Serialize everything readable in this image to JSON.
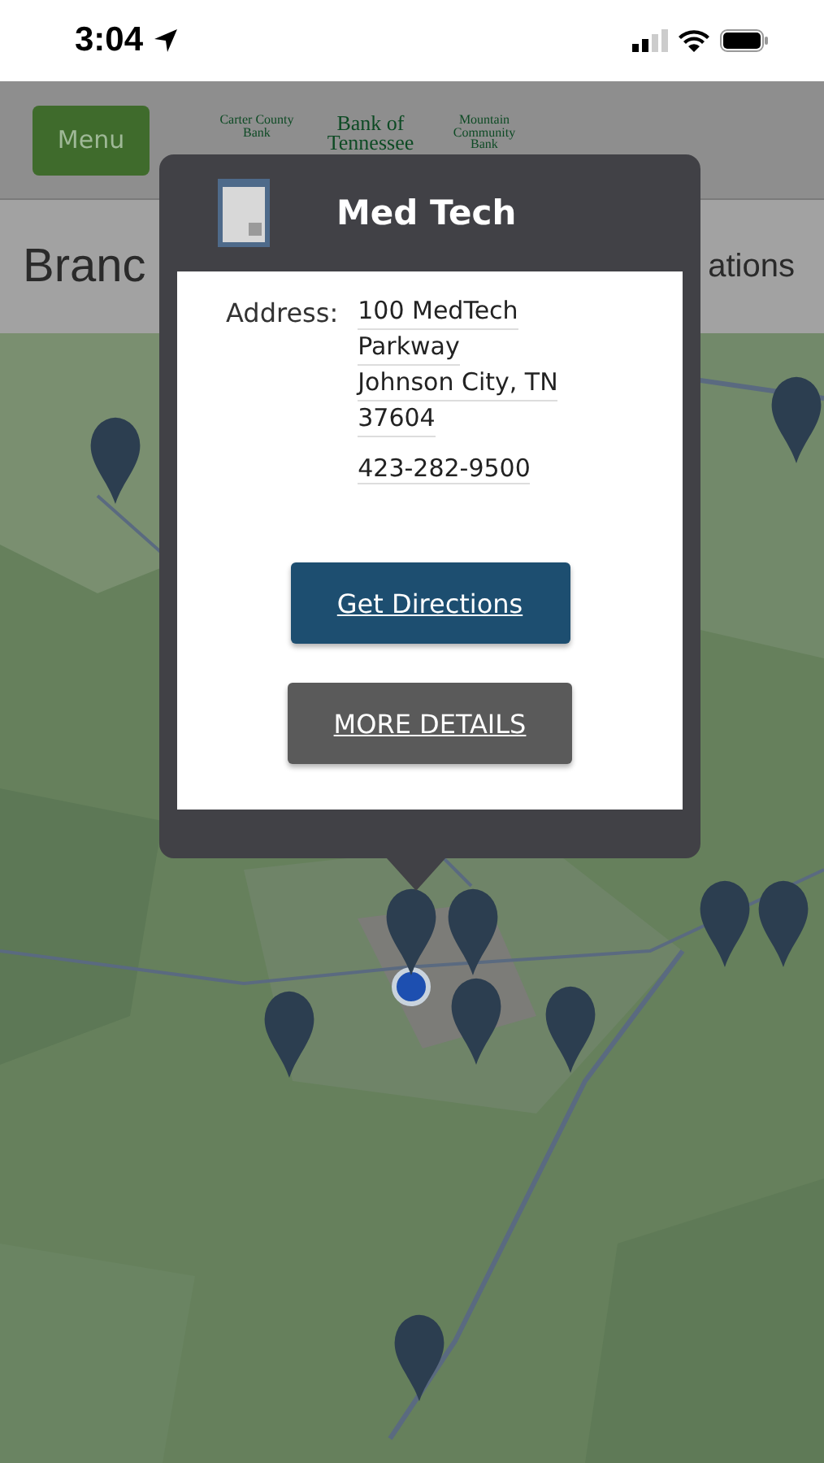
{
  "status_bar": {
    "time": "3:04"
  },
  "header": {
    "menu_button": "Menu",
    "logos": [
      "Carter County Bank",
      "Bank of Tennessee",
      "Mountain Community Bank"
    ]
  },
  "title_row": {
    "left_text": "Branc",
    "right_text": "ations"
  },
  "popup": {
    "title": "Med Tech",
    "address_label": "Address:",
    "address_lines": [
      "100 MedTech",
      "Parkway",
      "Johnson City, TN",
      "37604"
    ],
    "phone": "423-282-9500",
    "buttons": [
      {
        "label": "Get Directions",
        "kind": "primary"
      },
      {
        "label": "MORE DETAILS",
        "kind": "secondary"
      }
    ]
  }
}
